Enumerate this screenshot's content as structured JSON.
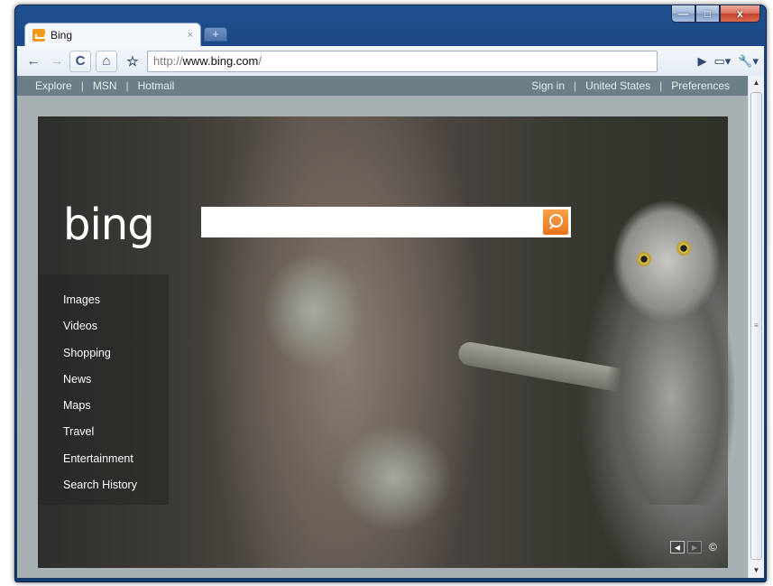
{
  "window": {
    "minimize": "—",
    "maximize": "□",
    "close": "x"
  },
  "tab": {
    "title": "Bing",
    "close": "×",
    "new_tab": "+"
  },
  "toolbar": {
    "back": "←",
    "forward": "→",
    "reload": "C",
    "home": "⌂",
    "star": "☆",
    "url": {
      "scheme": "http://",
      "host": "www.bing.com",
      "path": "/"
    },
    "go": "▶",
    "page_menu": "▭▾",
    "tools_menu": "🔧▾"
  },
  "bing": {
    "topbar": {
      "left": [
        "Explore",
        "MSN",
        "Hotmail"
      ],
      "right": [
        "Sign in",
        "United States",
        "Preferences"
      ]
    },
    "logo": "bing",
    "search": {
      "placeholder": "",
      "value": ""
    },
    "nav": [
      "Images",
      "Videos",
      "Shopping",
      "News",
      "Maps",
      "Travel",
      "Entertainment",
      "Search History"
    ],
    "controls": {
      "prev": "◀",
      "next": "▶",
      "copyright": "©"
    }
  },
  "scrollbar": {
    "up": "▲",
    "grip": "≡",
    "down": "▼"
  },
  "colors": {
    "accent_search": "#e8751c",
    "frame": "#16407a",
    "topbar": "#6d7f86"
  }
}
